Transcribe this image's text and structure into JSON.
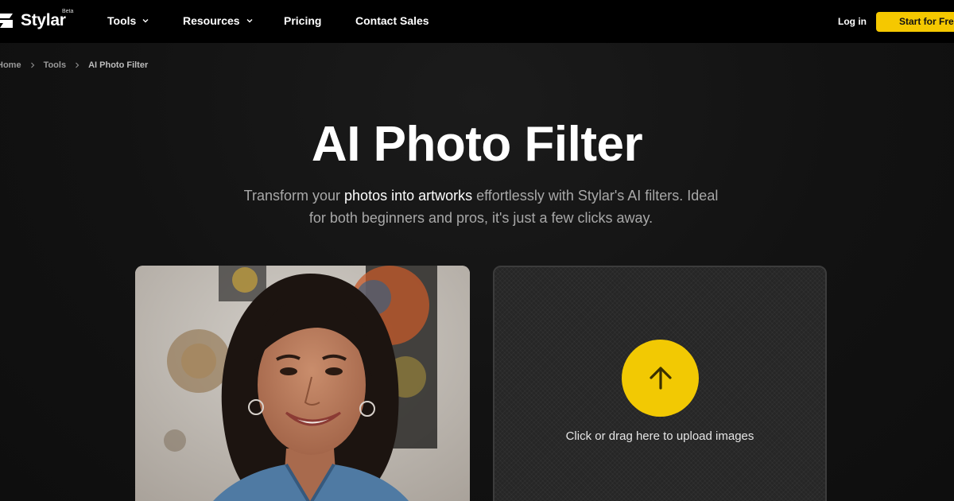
{
  "nav": {
    "logo_text": "Stylar",
    "logo_badge": "Beta",
    "items": [
      {
        "label": "Tools",
        "has_dropdown": true
      },
      {
        "label": "Resources",
        "has_dropdown": true
      },
      {
        "label": "Pricing",
        "has_dropdown": false
      },
      {
        "label": "Contact Sales",
        "has_dropdown": false
      }
    ],
    "login_label": "Log in",
    "cta_label": "Start for Free"
  },
  "breadcrumb": [
    "Home",
    "Tools",
    "AI Photo Filter"
  ],
  "hero": {
    "title": "AI Photo Filter",
    "subtitle_pre": "Transform your ",
    "subtitle_highlight": "photos into artworks",
    "subtitle_post": " effortlessly with Stylar's AI filters. Ideal for both beginners and pros, it's just a few clicks away."
  },
  "upload": {
    "label": "Click or drag here to upload images",
    "icon": "arrow-up-icon"
  },
  "colors": {
    "accent": "#f5c800",
    "nav_background": "#000000",
    "page_background": "#151515"
  }
}
